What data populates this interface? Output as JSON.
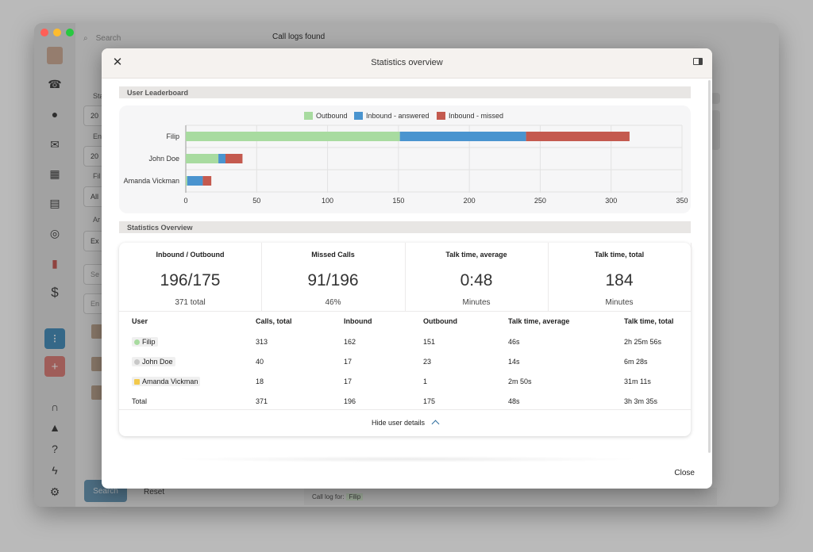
{
  "background": {
    "search_placeholder": "Search",
    "header_title": "Call logs found",
    "labels": [
      "Sta",
      "En",
      "Fil",
      "Ar"
    ],
    "fields": [
      "20",
      "20",
      "All",
      "Ex"
    ],
    "small_placeholders": [
      "Se",
      "En"
    ],
    "search_button": "Search",
    "reset_button": "Reset",
    "call_log_text": "Call log for:",
    "call_log_user": "Filip",
    "sidebar_icons": [
      "phone-icon",
      "chat-icon",
      "mail-icon",
      "calendar-icon",
      "clipboard-icon",
      "support-icon",
      "stats-icon",
      "dollar-icon",
      "headset-icon",
      "bell-icon",
      "help-icon",
      "bolt-icon",
      "gear-icon"
    ]
  },
  "modal": {
    "title": "Statistics overview",
    "close_label": "Close",
    "leaderboard_header": "User Leaderboard",
    "overview_header": "Statistics Overview",
    "hide_details": "Hide user details"
  },
  "chart_data": {
    "type": "bar",
    "orientation": "horizontal",
    "stacked": true,
    "categories": [
      "Filip",
      "John Doe",
      "Amanda Vickman"
    ],
    "series": [
      {
        "name": "Outbound",
        "color": "#a8dba0",
        "values": [
          151,
          23,
          1
        ]
      },
      {
        "name": "Inbound - answered",
        "color": "#4a94cf",
        "values": [
          89,
          5,
          11
        ]
      },
      {
        "name": "Inbound - missed",
        "color": "#c45a4f",
        "values": [
          73,
          12,
          6
        ]
      }
    ],
    "xlim": [
      0,
      350
    ],
    "xticks": [
      0,
      50,
      100,
      150,
      200,
      250,
      300,
      350
    ],
    "grid": true,
    "legend": "top-center"
  },
  "stats": [
    {
      "title": "Inbound / Outbound",
      "value": "196/175",
      "sub": "371 total"
    },
    {
      "title": "Missed Calls",
      "value": "91/196",
      "sub": "46%"
    },
    {
      "title": "Talk time, average",
      "value": "0:48",
      "sub": "Minutes"
    },
    {
      "title": "Talk time, total",
      "value": "184",
      "sub": "Minutes"
    }
  ],
  "table": {
    "headers": [
      "User",
      "Calls, total",
      "Inbound",
      "Outbound",
      "Talk time, average",
      "Talk time, total"
    ],
    "rows": [
      {
        "user": "Filip",
        "color": "#a8dba0",
        "calls": "313",
        "inbound": "162",
        "outbound": "151",
        "avg": "46s",
        "total": "2h 25m 56s"
      },
      {
        "user": "John Doe",
        "color": "#c8c8c8",
        "calls": "40",
        "inbound": "17",
        "outbound": "23",
        "avg": "14s",
        "total": "6m 28s"
      },
      {
        "user": "Amanda Vickman",
        "color": "#f2c94c",
        "calls": "18",
        "inbound": "17",
        "outbound": "1",
        "avg": "2m 50s",
        "total": "31m 11s"
      }
    ],
    "total_row": {
      "user": "Total",
      "calls": "371",
      "inbound": "196",
      "outbound": "175",
      "avg": "48s",
      "total": "3h 3m 35s"
    }
  }
}
